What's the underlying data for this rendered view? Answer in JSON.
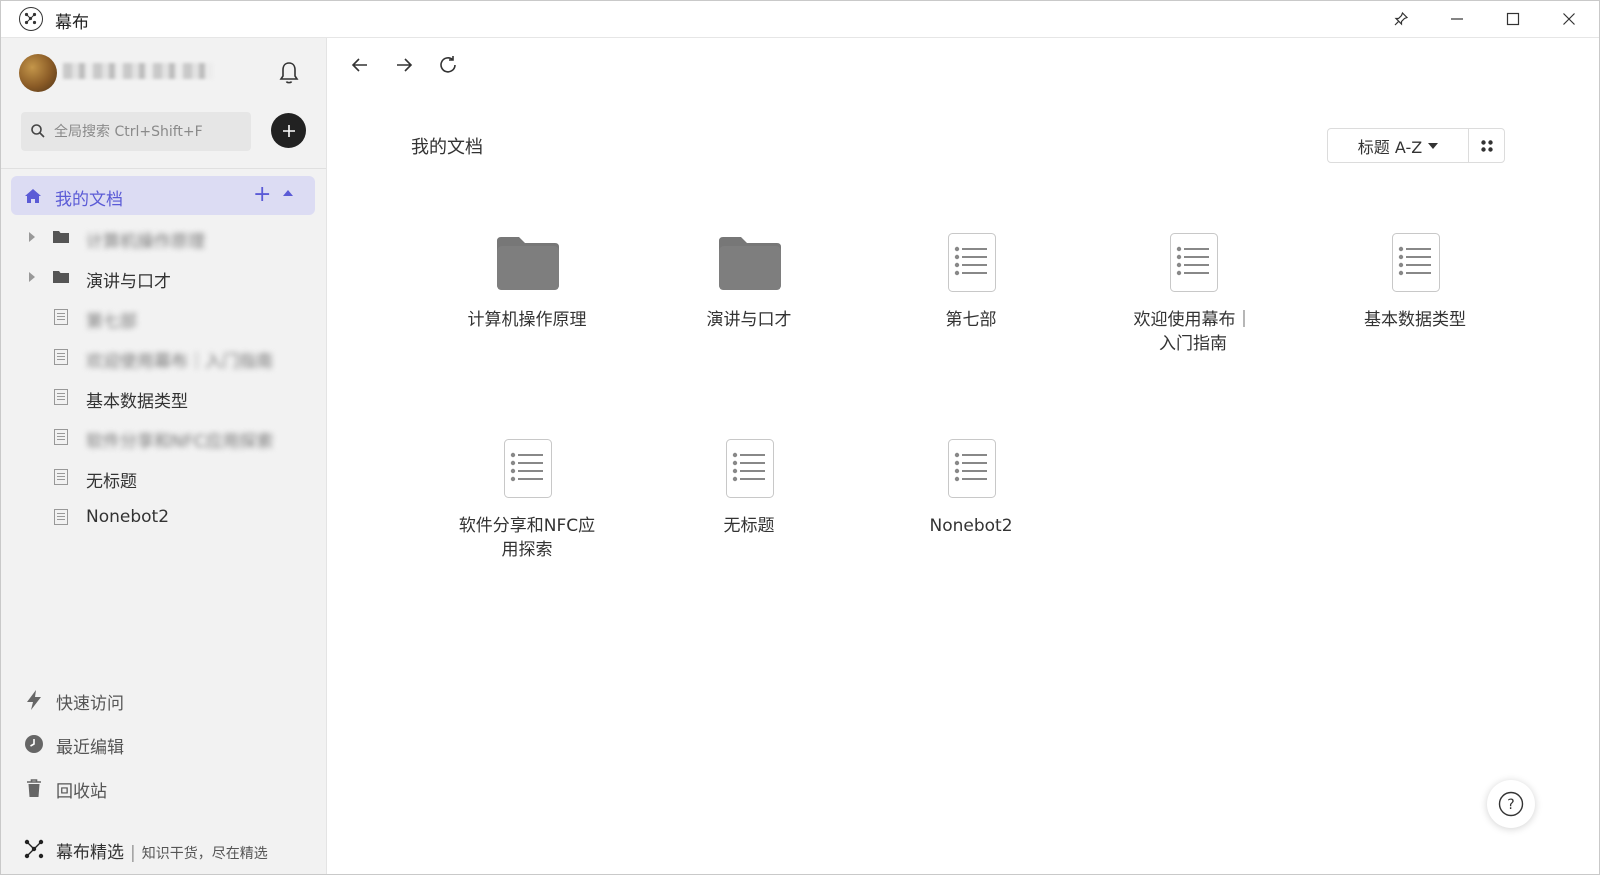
{
  "app": {
    "title": "幕布"
  },
  "titlebar": {
    "pin_icon": "pin-icon",
    "minimize_icon": "minimize-icon",
    "maximize_icon": "maximize-icon",
    "close_icon": "close-icon"
  },
  "sidebar": {
    "search": {
      "placeholder": "全局搜索 Ctrl+Shift+F"
    },
    "my_docs": {
      "label": "我的文档",
      "expanded": true
    },
    "tree": [
      {
        "label": "计算机操作原理",
        "type": "folder",
        "blurred": true
      },
      {
        "label": "演讲与口才",
        "type": "folder",
        "blurred": false
      },
      {
        "label": "第七部",
        "type": "doc",
        "blurred": true
      },
      {
        "label": "欢迎使用幕布｜入门指南",
        "type": "doc",
        "blurred": true
      },
      {
        "label": "基本数据类型",
        "type": "doc",
        "blurred": false
      },
      {
        "label": "软件分享和NFC应用探索",
        "type": "doc",
        "blurred": true
      },
      {
        "label": "无标题",
        "type": "doc",
        "blurred": false
      },
      {
        "label": "Nonebot2",
        "type": "doc",
        "blurred": false
      }
    ],
    "bottom_nav": [
      {
        "label": "快速访问",
        "icon": "lightning-icon"
      },
      {
        "label": "最近编辑",
        "icon": "clock-icon"
      },
      {
        "label": "回收站",
        "icon": "trash-icon"
      }
    ],
    "featured": {
      "label": "幕布精选",
      "separator": "|",
      "subtitle": "知识干货，尽在精选"
    }
  },
  "main": {
    "title": "我的文档",
    "sort_label": "标题 A-Z",
    "items": [
      {
        "label": "计算机操作原理",
        "type": "folder"
      },
      {
        "label": "演讲与口才",
        "type": "folder"
      },
      {
        "label": "第七部",
        "type": "doc"
      },
      {
        "label": "欢迎使用幕布｜入门指南",
        "type": "doc"
      },
      {
        "label": "基本数据类型",
        "type": "doc"
      },
      {
        "label": "软件分享和NFC应用探索",
        "type": "doc"
      },
      {
        "label": "无标题",
        "type": "doc"
      },
      {
        "label": "Nonebot2",
        "type": "doc"
      }
    ]
  },
  "help": {
    "label": "?"
  },
  "colors": {
    "accent": "#5b5bd6",
    "selected_bg": "#dcdcf3",
    "sidebar_bg": "#f2f2f2",
    "folder": "#7a7a7a"
  }
}
